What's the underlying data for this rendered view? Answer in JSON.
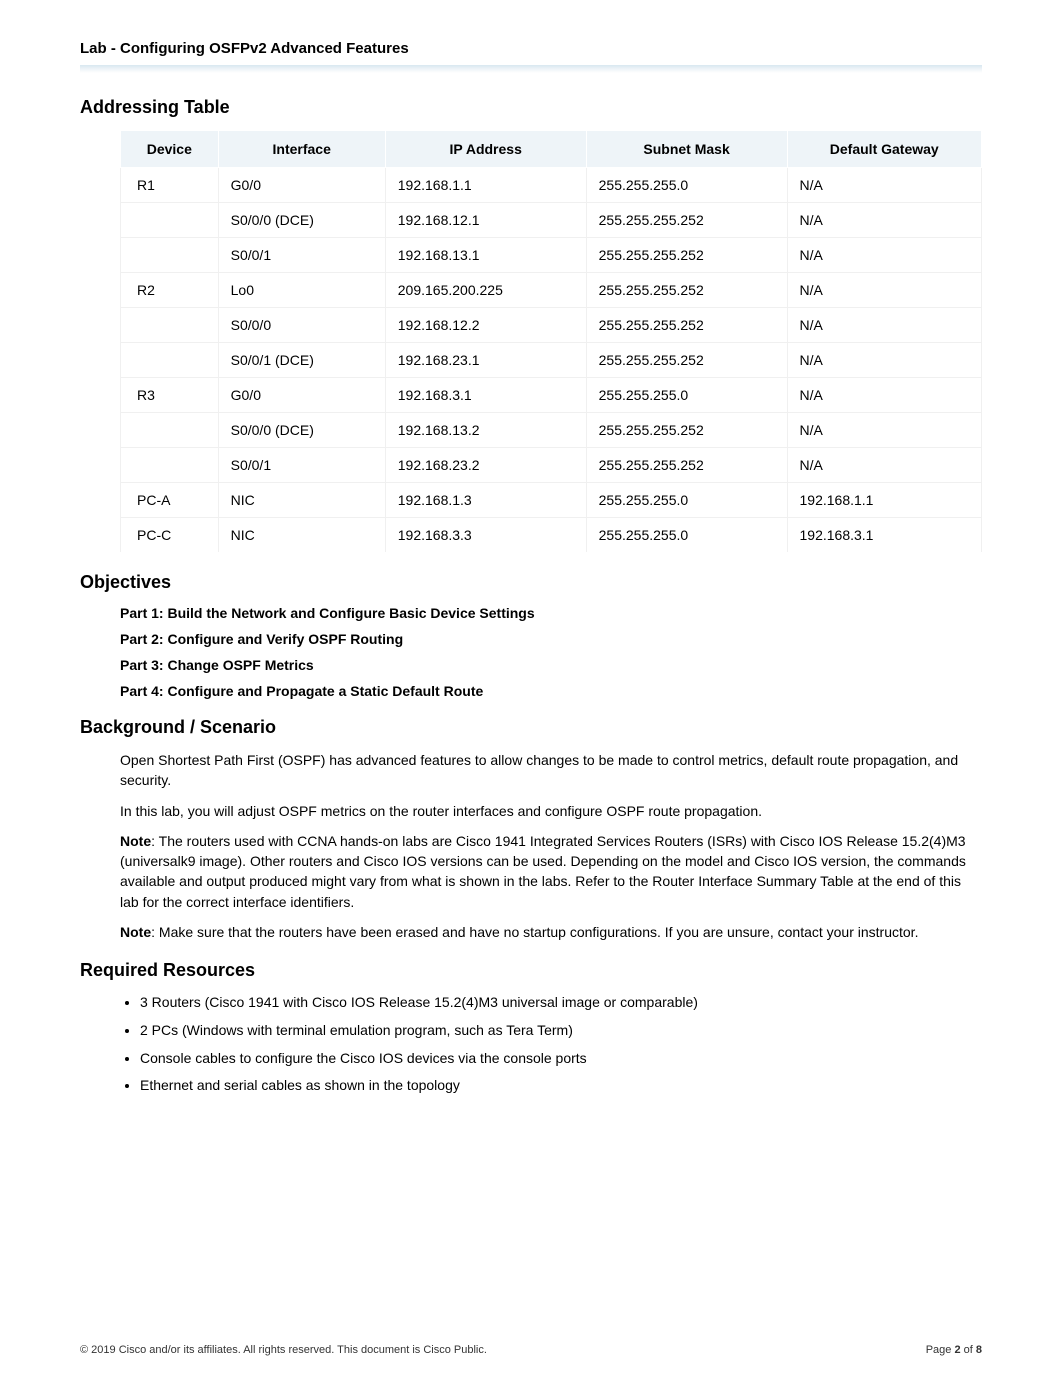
{
  "header": {
    "title": "Lab - Configuring OSFPv2 Advanced Features"
  },
  "sections": {
    "addressing": "Addressing Table",
    "objectives": "Objectives",
    "background": "Background / Scenario",
    "resources": "Required Resources"
  },
  "table": {
    "headers": [
      "Device",
      "Interface",
      "IP Address",
      "Subnet Mask",
      "Default Gateway"
    ],
    "rows": [
      {
        "device": "R1",
        "iface": "G0/0",
        "ip": "192.168.1.1",
        "mask": "255.255.255.0",
        "gw": "N/A"
      },
      {
        "device": "",
        "iface": "S0/0/0 (DCE)",
        "ip": "192.168.12.1",
        "mask": "255.255.255.252",
        "gw": "N/A"
      },
      {
        "device": "",
        "iface": "S0/0/1",
        "ip": "192.168.13.1",
        "mask": "255.255.255.252",
        "gw": "N/A"
      },
      {
        "device": "R2",
        "iface": "Lo0",
        "ip": "209.165.200.225",
        "mask": "255.255.255.252",
        "gw": "N/A"
      },
      {
        "device": "",
        "iface": "S0/0/0",
        "ip": "192.168.12.2",
        "mask": "255.255.255.252",
        "gw": "N/A"
      },
      {
        "device": "",
        "iface": "S0/0/1 (DCE)",
        "ip": "192.168.23.1",
        "mask": "255.255.255.252",
        "gw": "N/A"
      },
      {
        "device": "R3",
        "iface": "G0/0",
        "ip": "192.168.3.1",
        "mask": "255.255.255.0",
        "gw": "N/A"
      },
      {
        "device": "",
        "iface": "S0/0/0 (DCE)",
        "ip": "192.168.13.2",
        "mask": "255.255.255.252",
        "gw": "N/A"
      },
      {
        "device": "",
        "iface": "S0/0/1",
        "ip": "192.168.23.2",
        "mask": "255.255.255.252",
        "gw": "N/A"
      },
      {
        "device": "PC-A",
        "iface": "NIC",
        "ip": "192.168.1.3",
        "mask": "255.255.255.0",
        "gw": "192.168.1.1"
      },
      {
        "device": "PC-C",
        "iface": "NIC",
        "ip": "192.168.3.3",
        "mask": "255.255.255.0",
        "gw": "192.168.3.1"
      }
    ]
  },
  "objectives_list": [
    "Part 1: Build the Network and Configure Basic Device Settings",
    "Part 2: Configure and Verify OSPF Routing",
    "Part 3: Change OSPF Metrics",
    "Part 4: Configure and Propagate a Static Default Route"
  ],
  "background": {
    "p1": "Open Shortest Path First (OSPF) has advanced features to allow changes to be made to control metrics, default route propagation, and security.",
    "p2": "In this lab, you will adjust OSPF metrics on the router interfaces and configure OSPF route propagation.",
    "note1_label": "Note",
    "note1_body": ": The routers used with CCNA hands-on labs are Cisco 1941 Integrated Services Routers (ISRs) with Cisco IOS Release 15.2(4)M3 (universalk9 image). Other routers and Cisco IOS versions can be used. Depending on the model and Cisco IOS version, the commands available and output produced might vary from what is shown in the labs. Refer to the Router Interface Summary Table at the end of this lab for the correct interface identifiers.",
    "note2_label": "Note",
    "note2_body": ": Make sure that the routers have been erased and have no startup configurations. If you are unsure, contact your instructor."
  },
  "resources_list": [
    "3 Routers (Cisco 1941 with Cisco IOS Release 15.2(4)M3 universal image or comparable)",
    "2 PCs (Windows with terminal emulation program, such as Tera Term)",
    "Console cables to configure the Cisco IOS devices via the console ports",
    "Ethernet and serial cables as shown in the topology"
  ],
  "footer": {
    "left": "© 2019 Cisco and/or its affiliates. All rights reserved. This document is Cisco Public.",
    "right_prefix": "Page ",
    "right_page": "2",
    "right_mid": " of ",
    "right_total": "8"
  }
}
